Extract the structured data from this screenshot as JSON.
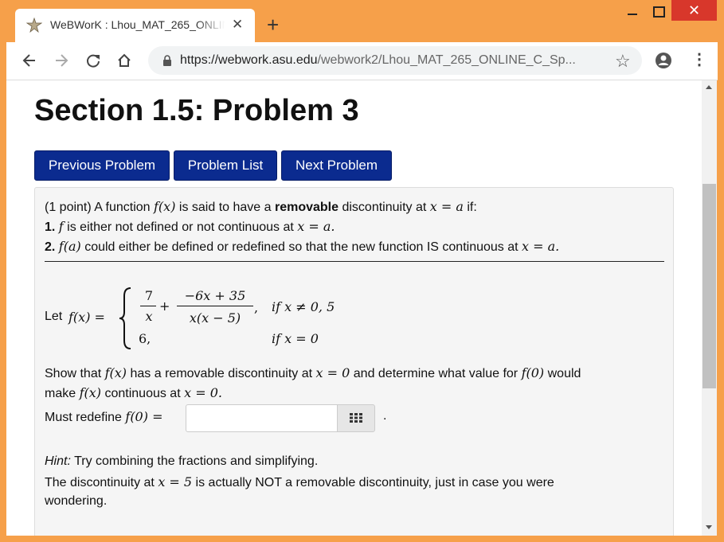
{
  "browser": {
    "tab_title": "WeBWorK : Lhou_MAT_265_ONLINE_C_Sp",
    "tab_close": "✕",
    "new_tab": "+",
    "url_host": "https://webwork.asu.edu",
    "url_path": "/webwork2/Lhou_MAT_265_ONLINE_C_Sp...",
    "window_close": "✕"
  },
  "page": {
    "title": "Section 1.5: Problem 3",
    "buttons": {
      "previous": "Previous Problem",
      "list": "Problem List",
      "next": "Next Problem"
    }
  },
  "problem": {
    "points": "(1 point)",
    "intro_a": "A function",
    "intro_f": "f(x)",
    "intro_b": "is said to have a",
    "intro_bold": "removable",
    "intro_c": "discontinuity at",
    "intro_math": "x = a",
    "intro_d": "if:",
    "cond1_num": "1.",
    "cond1_f": "f",
    "cond1_text": "is either not defined or not continuous at",
    "cond1_math": "x = a.",
    "cond2_num": "2.",
    "cond2_f": "f(a)",
    "cond2_text": "could either be defined or redefined so that the new function IS continuous at",
    "cond2_math": "x = a.",
    "let_label": "Let",
    "let_lhs": "f(x) =",
    "piece1_num1": "7",
    "piece1_den1": "x",
    "piece1_plus": "+",
    "piece1_num2": "−6x + 35",
    "piece1_den2": "x(x − 5)",
    "piece1_comma": ",",
    "piece1_cond": "if x ≠ 0, 5",
    "piece2_val": "6,",
    "piece2_cond": "if x = 0",
    "show_a": "Show that",
    "show_f": "f(x)",
    "show_b": "has a removable discontinuity at",
    "show_math": "x = 0",
    "show_c": "and determine what value for",
    "show_f0": "f(0)",
    "show_d": "would",
    "make_a": "make",
    "make_f": "f(x)",
    "make_b": "continuous at",
    "make_math": "x = 0.",
    "redefine_label": "Must redefine",
    "redefine_math": "f(0) =",
    "answer_value": "",
    "answer_period": ".",
    "hint_label": "Hint:",
    "hint_text": "Try combining the fractions and simplifying.",
    "note_a": "The discontinuity at",
    "note_math": "x = 5",
    "note_b": "is actually NOT a removable discontinuity, just in case you were",
    "note_c": "wondering."
  },
  "colors": {
    "window_frame": "#f6a04a",
    "button_bg": "#0b2b8f",
    "close_btn": "#d8372b"
  }
}
